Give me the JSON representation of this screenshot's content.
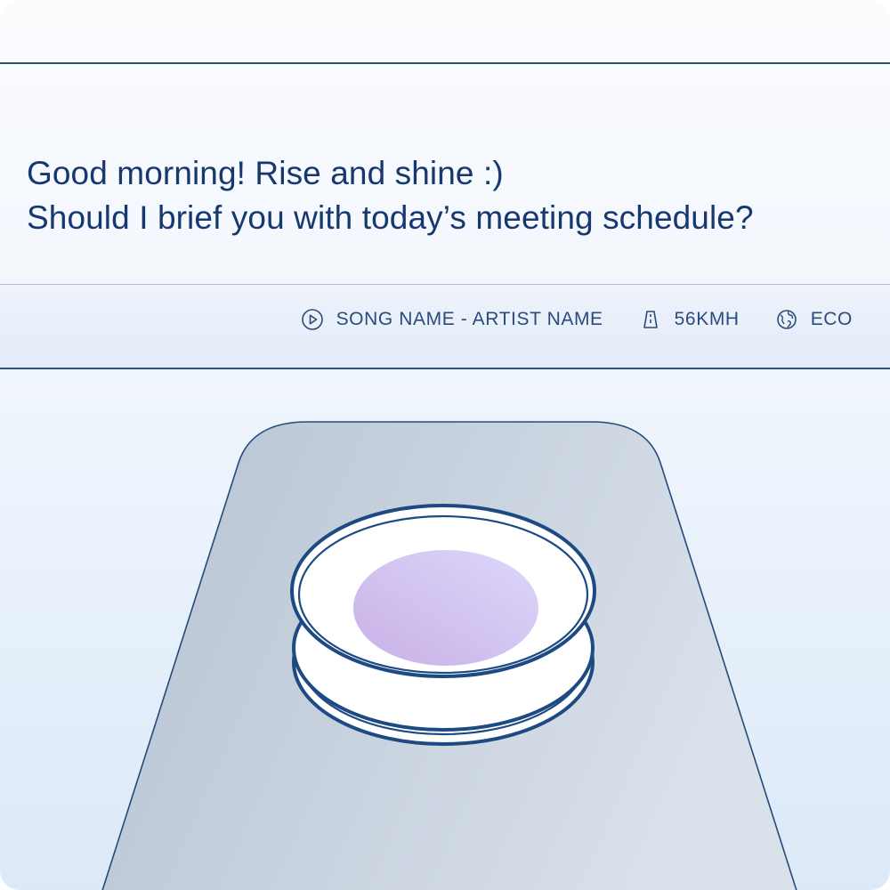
{
  "assistant": {
    "greeting_line1": "Good morning! Rise and shine :)",
    "greeting_line2": "Should I brief you with today’s meeting schedule?"
  },
  "status_bar": {
    "now_playing": "SONG NAME - ARTIST NAME",
    "now_playing_icon": "play-circle-icon",
    "speed": "56KMH",
    "speed_icon": "road-icon",
    "mode": "ECO",
    "mode_icon": "globe-icon"
  },
  "colors": {
    "text_primary": "#17386e",
    "accent_navy": "#1d4a82",
    "orb_glow": "#cdb8ec"
  }
}
